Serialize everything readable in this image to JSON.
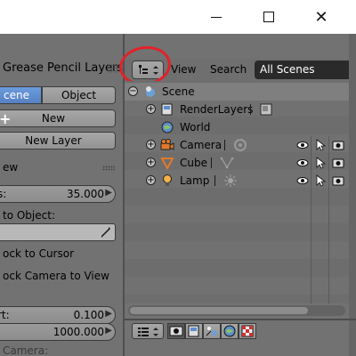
{
  "window": {
    "min_icon": "minimize-icon",
    "max_icon": "maximize-icon",
    "close_icon": "close-icon",
    "close_glyph": "✕"
  },
  "left_panel": {
    "title": "Grease Pencil Layers",
    "seg_scene": "cene",
    "seg_object": "Object",
    "new_label": "New",
    "new_layer_label": "New Layer",
    "view_label": "ew",
    "distance_label": "s:",
    "distance_value": "35.000",
    "to_object_label": "to Object:",
    "lock_cursor_label": "ock to Cursor",
    "lock_camera_label": "ock Camera to View",
    "start_label": "rt:",
    "start_value": "0.100",
    "end_label": "",
    "end_value": "1000.000",
    "camera_label": "Camera:",
    "accent_active": "#5680c2"
  },
  "outliner": {
    "view_label": "View",
    "search_label": "Search",
    "scenes_value": "All Scenes",
    "highlight_color": "#e2222a",
    "tree": [
      {
        "label": "Scene",
        "icon": "scene-icon"
      },
      {
        "label": "RenderLayers",
        "icon": "renderlayers-icon"
      },
      {
        "label": "World",
        "icon": "world-icon"
      },
      {
        "label": "Camera",
        "icon": "camera-icon"
      },
      {
        "label": "Cube",
        "icon": "cube-icon"
      },
      {
        "label": "Lamp",
        "icon": "lamp-icon"
      }
    ]
  }
}
